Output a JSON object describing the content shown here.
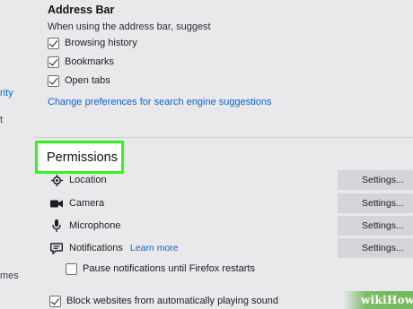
{
  "sidebar": {
    "fragments": [
      "rity",
      "t",
      "mes"
    ]
  },
  "address_bar": {
    "title": "Address Bar",
    "subtitle": "When using the address bar, suggest",
    "options": [
      {
        "label": "Browsing history",
        "checked": true
      },
      {
        "label": "Bookmarks",
        "checked": true
      },
      {
        "label": "Open tabs",
        "checked": true
      }
    ],
    "search_prefs_link": "Change preferences for search engine suggestions"
  },
  "permissions": {
    "title": "Permissions",
    "rows": [
      {
        "label": "Location",
        "icon": "location-icon",
        "button": "Settings..."
      },
      {
        "label": "Camera",
        "icon": "camera-icon",
        "button": "Settings..."
      },
      {
        "label": "Microphone",
        "icon": "microphone-icon",
        "button": "Settings..."
      },
      {
        "label": "Notifications",
        "icon": "notifications-icon",
        "button": "Settings...",
        "link": "Learn more"
      }
    ],
    "pause_notifications": {
      "label": "Pause notifications until Firefox restarts",
      "checked": false
    },
    "block_autoplay": {
      "label": "Block websites from automatically playing sound",
      "checked": true
    }
  },
  "watermark": {
    "text": "wikiHow"
  },
  "colors": {
    "background": "#e9e9ec",
    "link": "#0a63c9",
    "highlight": "#2ff51b",
    "button": "#d4d4d9"
  }
}
